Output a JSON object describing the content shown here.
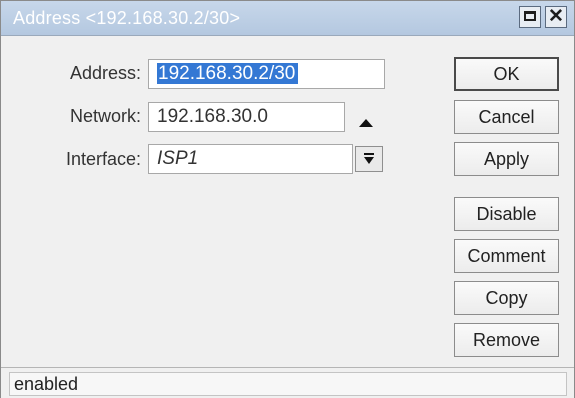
{
  "window": {
    "title": "Address <192.168.30.2/30>",
    "maximize_icon": "maximize-icon",
    "close_icon": "close-icon"
  },
  "form": {
    "address": {
      "label": "Address:",
      "value": "192.168.30.2/30"
    },
    "network": {
      "label": "Network:",
      "value": "192.168.30.0",
      "toggle_icon": "up-arrow-icon"
    },
    "interface": {
      "label": "Interface:",
      "value": "ISP1",
      "dropdown_icon": "dropdown-arrow-icon"
    }
  },
  "buttons": {
    "ok": "OK",
    "cancel": "Cancel",
    "apply": "Apply",
    "disable": "Disable",
    "comment": "Comment",
    "copy": "Copy",
    "remove": "Remove"
  },
  "status": {
    "text": "enabled"
  },
  "colors": {
    "titlebar": "#b4c8e0",
    "selection": "#3478d4"
  }
}
